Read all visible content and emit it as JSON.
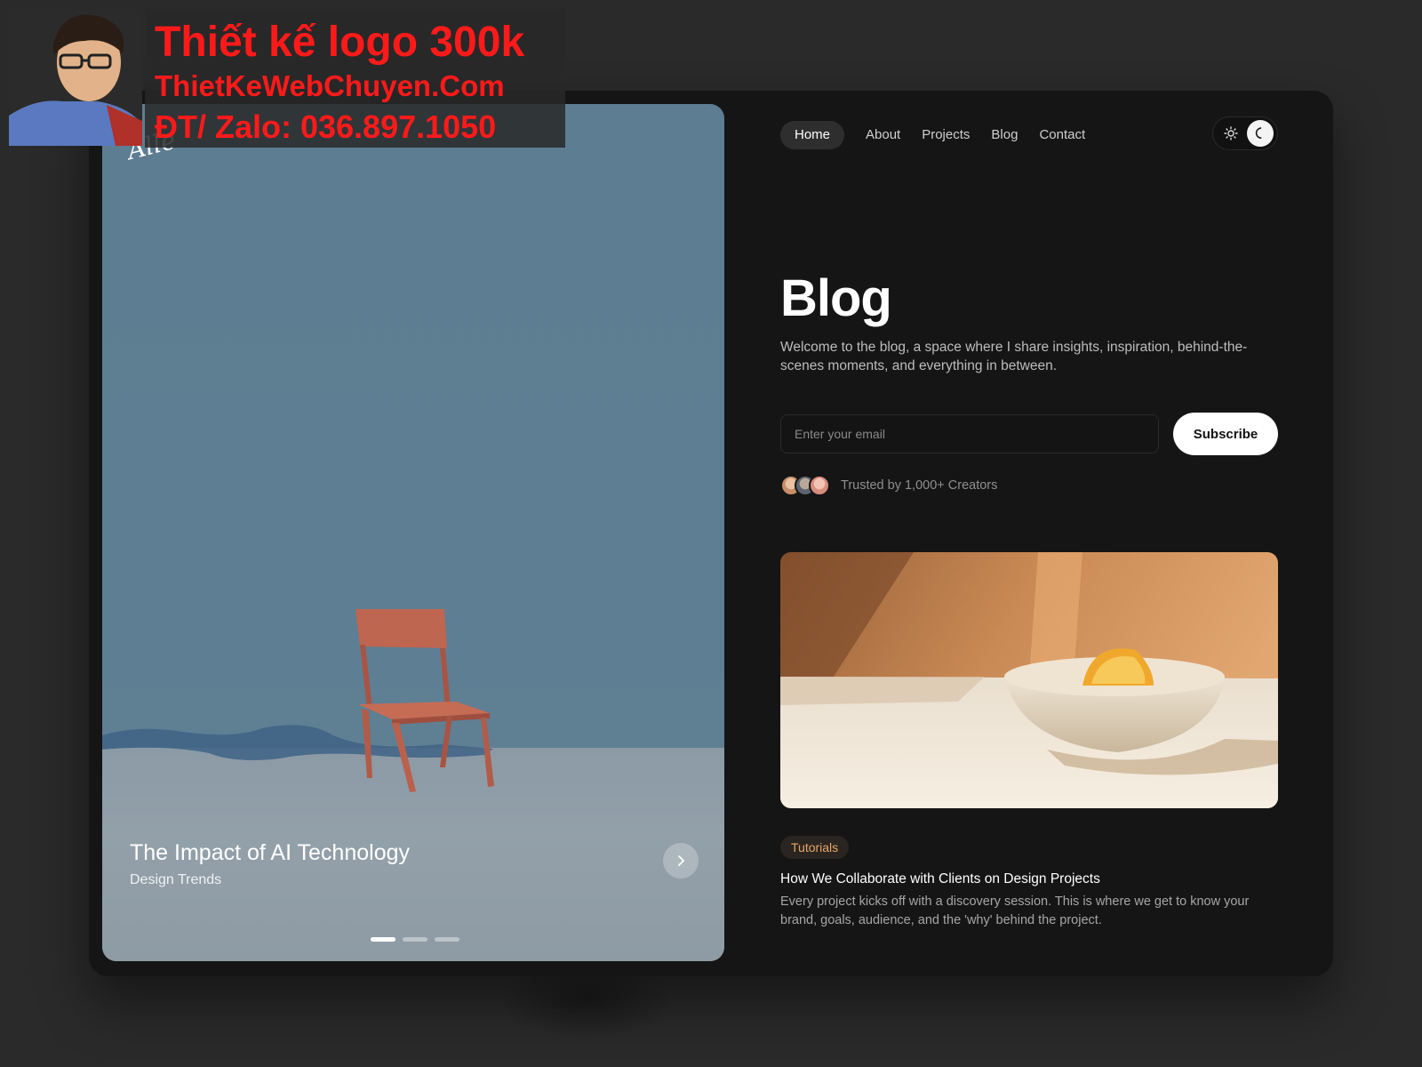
{
  "hero": {
    "logo": "Alle",
    "title": "The Impact of AI Technology",
    "subtitle": "Design Trends",
    "slides_total": 3,
    "slide_active": 1
  },
  "nav": {
    "items": [
      {
        "label": "Home",
        "active": true
      },
      {
        "label": "About",
        "active": false
      },
      {
        "label": "Projects",
        "active": false
      },
      {
        "label": "Blog",
        "active": false
      },
      {
        "label": "Contact",
        "active": false
      }
    ],
    "theme": "dark"
  },
  "main": {
    "title": "Blog",
    "description": "Welcome to the blog, a space where I share insights, inspiration, behind-the-scenes moments, and everything in between.",
    "email_placeholder": "Enter your email",
    "subscribe_label": "Subscribe",
    "trusted_text": "Trusted by 1,000+ Creators"
  },
  "post": {
    "tag": "Tutorials",
    "title": "How We Collaborate with Clients on Design Projects",
    "description": "Every project kicks off with a discovery session. This is where we get to know your brand, goals, audience, and the 'why' behind the project."
  },
  "promo": {
    "line1": "Thiết kế logo 300k",
    "line2": "ThietKeWebChuyen.Com",
    "line3": "ĐT/ Zalo: 036.897.1050"
  },
  "colors": {
    "page_bg": "#2a2a2b",
    "frame_bg": "#151515",
    "accent_tag": "#e6a66a",
    "promo_red": "#ff1a1a"
  }
}
